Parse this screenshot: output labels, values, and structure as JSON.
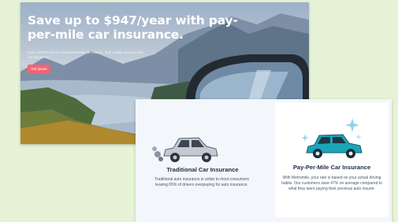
{
  "hero": {
    "headline": "Save up to $947/year with pay-per-mile car insurance.",
    "subtext": "Over 100,000 drivers trust Metromile for reliable, high quality pay-per-mile car insurance.",
    "cta_label": "Get Quote"
  },
  "comparison": {
    "traditional": {
      "title": "Traditional Car Insurance",
      "body": "Traditional auto insurance is unfair to most consumers leaving 65% of drivers overpaying for auto insurance."
    },
    "pay_per_mile": {
      "title": "Pay-Per-Mile Car Insurance",
      "body": "With Metromile, your rate is based on your actual driving habits. Our customers save 47% on average compared to what they were paying their previous auto insurer."
    }
  },
  "colors": {
    "page_bg": "#e6f3d6",
    "cta": "#f26471",
    "heading": "#1f2c44",
    "car_traditional": "#c4cad3",
    "car_ppm": "#1aa6b8"
  }
}
